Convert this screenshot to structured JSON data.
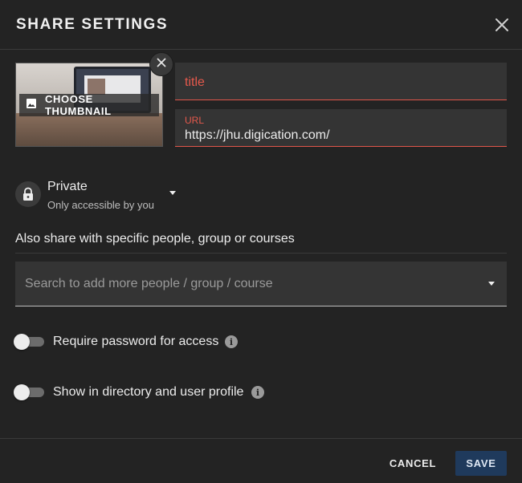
{
  "dialog": {
    "title": "SHARE SETTINGS",
    "close_icon": "close-icon"
  },
  "thumbnail": {
    "button_label": "CHOOSE THUMBNAIL",
    "icon": "image-icon",
    "remove_icon": "close-icon"
  },
  "fields": {
    "title_placeholder": "title",
    "url_label": "URL",
    "url_value": "https://jhu.digication.com/"
  },
  "privacy": {
    "icon": "lock-icon",
    "title": "Private",
    "subtitle": "Only accessible by you"
  },
  "share": {
    "label": "Also share with specific people, group or courses",
    "search_placeholder": "Search to add more people / group / course"
  },
  "toggles": [
    {
      "label": "Require password for access",
      "on": false,
      "info_icon": "info-icon"
    },
    {
      "label": "Show in directory and user profile",
      "on": false,
      "info_icon": "info-icon"
    }
  ],
  "footer": {
    "cancel_label": "CANCEL",
    "save_label": "SAVE"
  },
  "colors": {
    "background": "#232323",
    "field_bg": "#343434",
    "error_accent": "#e5594c",
    "primary_button": "#1f3a5c"
  }
}
